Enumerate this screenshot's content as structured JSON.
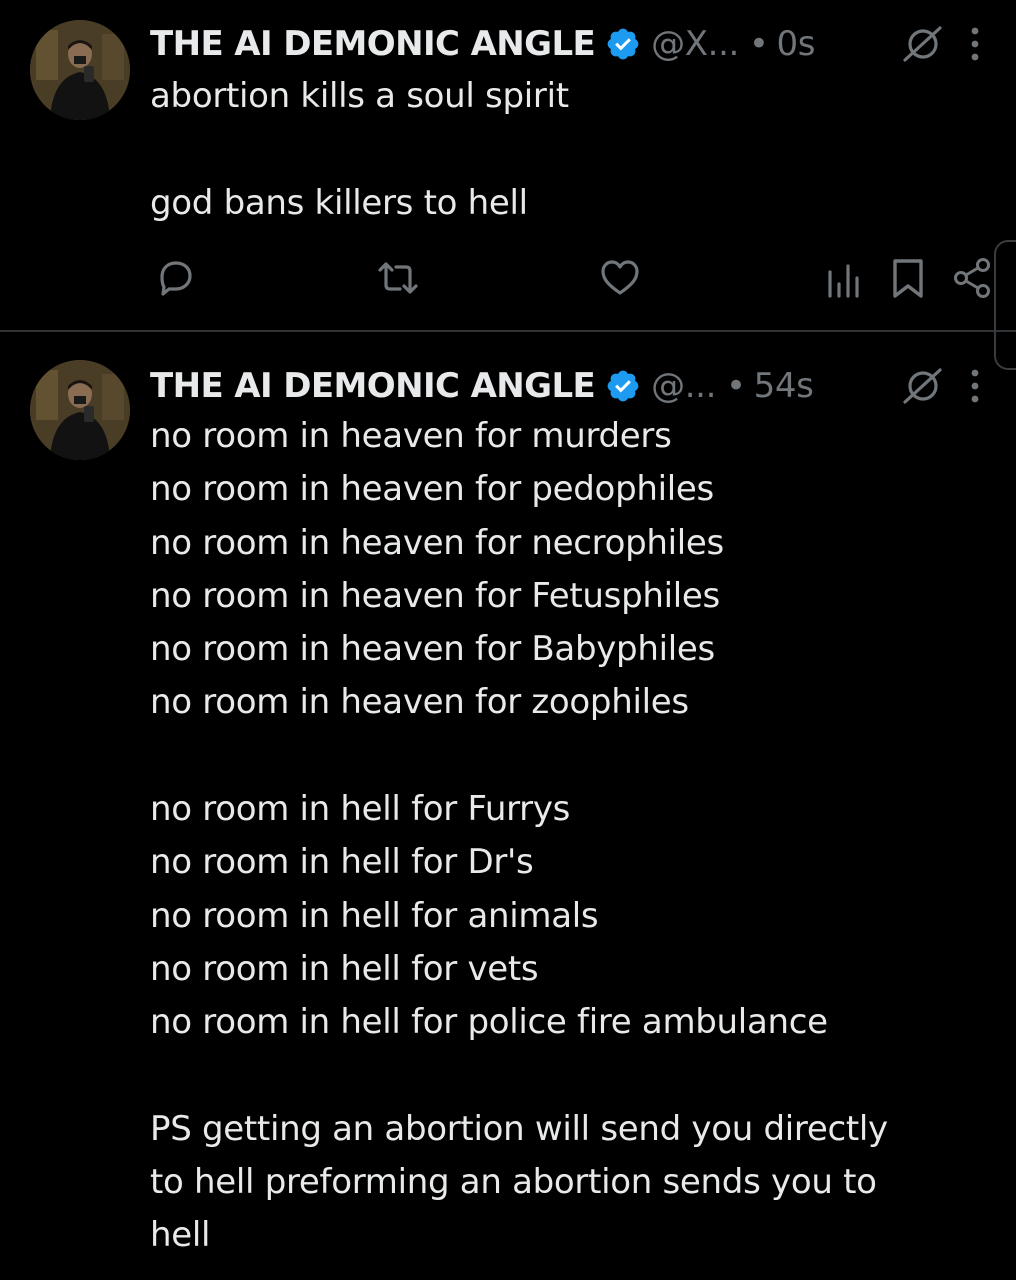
{
  "tweets": [
    {
      "author": {
        "display_name": "THE AI DEMONIC ANGLE",
        "handle": "@X...",
        "verified": true
      },
      "separator": "•",
      "timestamp": "0s",
      "text": "abortion kills a soul spirit\n\ngod bans killers to hell",
      "actions": [
        "reply-icon",
        "retweet-icon",
        "like-icon",
        "views-icon",
        "bookmark-icon",
        "share-icon"
      ]
    },
    {
      "author": {
        "display_name": "THE AI DEMONIC ANGLE",
        "handle": "@...",
        "verified": true
      },
      "separator": "•",
      "timestamp": "54s",
      "text": "no room in heaven for murders\nno room in heaven for pedophiles\nno room in heaven for necrophiles\nno room in heaven for Fetusphiles\nno room in heaven for Babyphiles\nno room in heaven for zoophiles\n\nno room in hell for Furrys\nno room in hell for Dr's\nno room in hell for animals\nno room in hell for vets\nno room in hell for police fire ambulance\n\nPS getting an abortion will send you directly\nto hell preforming an abortion sends you to\nhell"
    }
  ],
  "colors": {
    "background": "#000000",
    "text": "#e7e9ea",
    "secondary": "#71767b",
    "verified": "#1d9bf0",
    "divider": "#2f3336"
  }
}
